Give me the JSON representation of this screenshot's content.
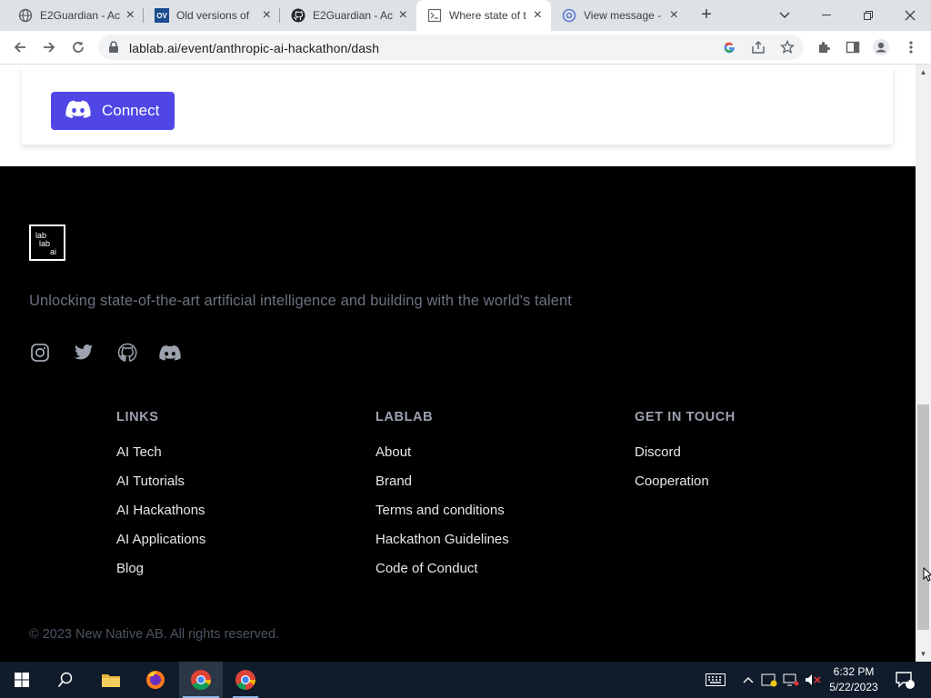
{
  "browser": {
    "tabs": [
      {
        "title": "E2Guardian - Ac",
        "icon": "globe-icon"
      },
      {
        "title": "Old versions of",
        "icon": "oldversion-icon",
        "icon_text": "OV"
      },
      {
        "title": "E2Guardian - Ac",
        "icon": "github-icon"
      },
      {
        "title": "Where state of t",
        "icon": "page-icon",
        "active": true
      },
      {
        "title": "View message -",
        "icon": "at-icon"
      }
    ],
    "url": "lablab.ai/event/anthropic-ai-hackathon/dash"
  },
  "page": {
    "connect_label": "Connect",
    "footer": {
      "logo_lines": [
        "lab",
        "lab",
        "ai"
      ],
      "tagline": "Unlocking state-of-the-art artificial intelligence and building with the world's talent",
      "social": [
        "instagram-icon",
        "twitter-icon",
        "github-icon",
        "discord-icon"
      ],
      "columns": [
        {
          "heading": "LINKS",
          "links": [
            "AI Tech",
            "AI Tutorials",
            "AI Hackathons",
            "AI Applications",
            "Blog"
          ]
        },
        {
          "heading": "LABLAB",
          "links": [
            "About",
            "Brand",
            "Terms and conditions",
            "Hackathon Guidelines",
            "Code of Conduct"
          ]
        },
        {
          "heading": "GET IN TOUCH",
          "links": [
            "Discord",
            "Cooperation"
          ]
        }
      ],
      "copyright": "© 2023 New Native AB. All rights reserved."
    }
  },
  "taskbar": {
    "time": "6:32 PM",
    "date": "5/22/2023",
    "notification_count": "3"
  },
  "colors": {
    "accent": "#4f46e5",
    "footer_bg": "#000000",
    "taskbar_bg": "#101b2b"
  }
}
